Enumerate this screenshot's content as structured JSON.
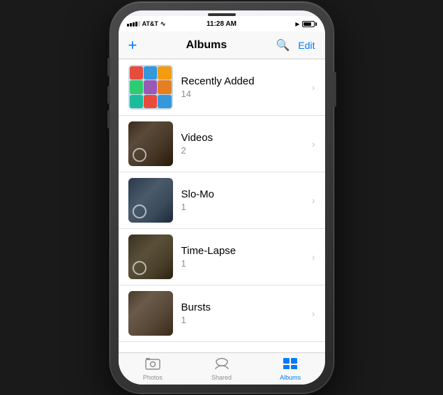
{
  "phone": {
    "status_bar": {
      "carrier": "AT&T",
      "signal": "●●●●○",
      "wifi": "wifi",
      "time": "11:28 AM",
      "battery_percent": 85
    },
    "nav": {
      "add_label": "+",
      "title": "Albums",
      "search_label": "🔍",
      "edit_label": "Edit"
    },
    "albums": [
      {
        "name": "Recently Added",
        "count": "14",
        "thumb_type": "recently"
      },
      {
        "name": "Videos",
        "count": "2",
        "thumb_type": "dark"
      },
      {
        "name": "Slo-Mo",
        "count": "1",
        "thumb_type": "dark2"
      },
      {
        "name": "Time-Lapse",
        "count": "1",
        "thumb_type": "dark3"
      },
      {
        "name": "Bursts",
        "count": "1",
        "thumb_type": "dark4"
      }
    ],
    "tabs": [
      {
        "id": "photos",
        "label": "Photos",
        "icon": "▣",
        "active": false
      },
      {
        "id": "shared",
        "label": "Shared",
        "icon": "☁",
        "active": false
      },
      {
        "id": "albums",
        "label": "Albums",
        "icon": "▪",
        "active": true
      }
    ]
  }
}
